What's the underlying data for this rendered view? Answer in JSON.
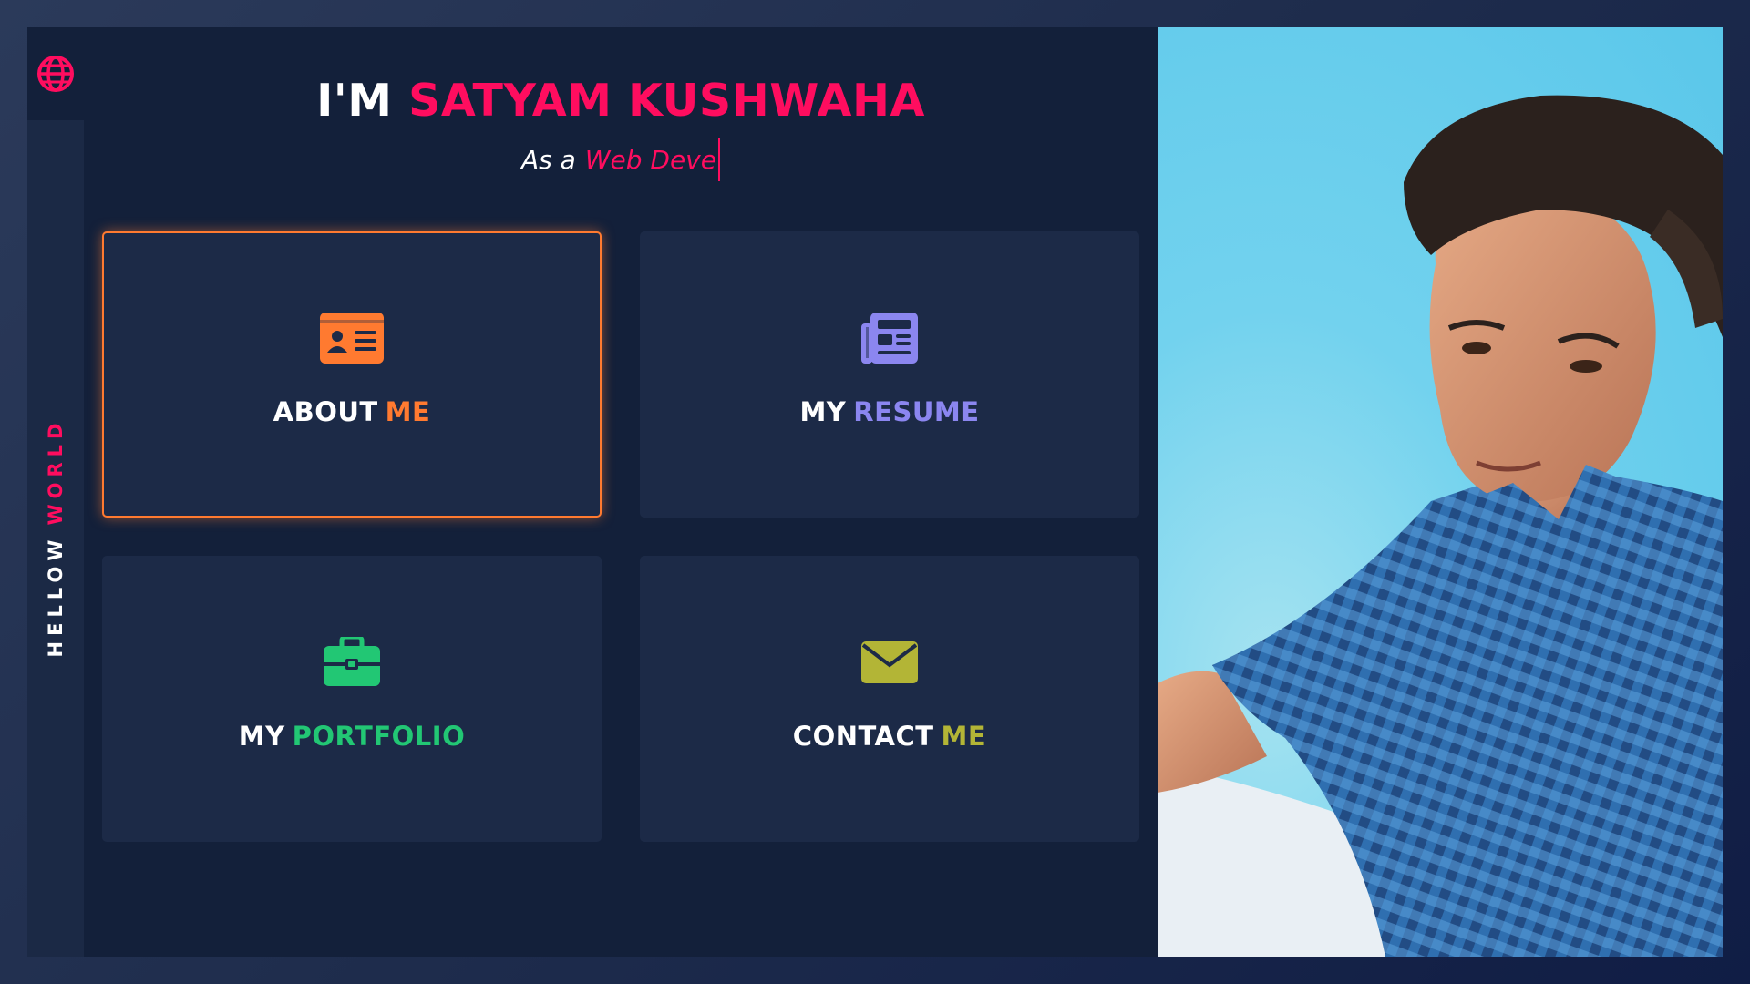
{
  "header": {
    "prefix": "I'M",
    "name": "SATYAM KUSHWAHA",
    "subtitle_prefix": "As a",
    "subtitle_typed": "Web Deve"
  },
  "sidebar": {
    "text_main": "HELLOW",
    "text_accent": "WORLD"
  },
  "cards": [
    {
      "label_main": "ABOUT",
      "label_accent": "ME",
      "icon": "id-card-icon",
      "color": "#ff7a30",
      "active": true
    },
    {
      "label_main": "MY",
      "label_accent": "RESUME",
      "icon": "newspaper-icon",
      "color": "#8b86f0",
      "active": false
    },
    {
      "label_main": "MY",
      "label_accent": "PORTFOLIO",
      "icon": "briefcase-icon",
      "color": "#22c774",
      "active": false
    },
    {
      "label_main": "CONTACT",
      "label_accent": "ME",
      "icon": "envelope-icon",
      "color": "#b3b536",
      "active": false
    }
  ],
  "colors": {
    "accent": "#ff0d5f",
    "panel": "#13203a",
    "card": "#1c2a47"
  },
  "photo": {
    "icon": "profile-photo"
  }
}
